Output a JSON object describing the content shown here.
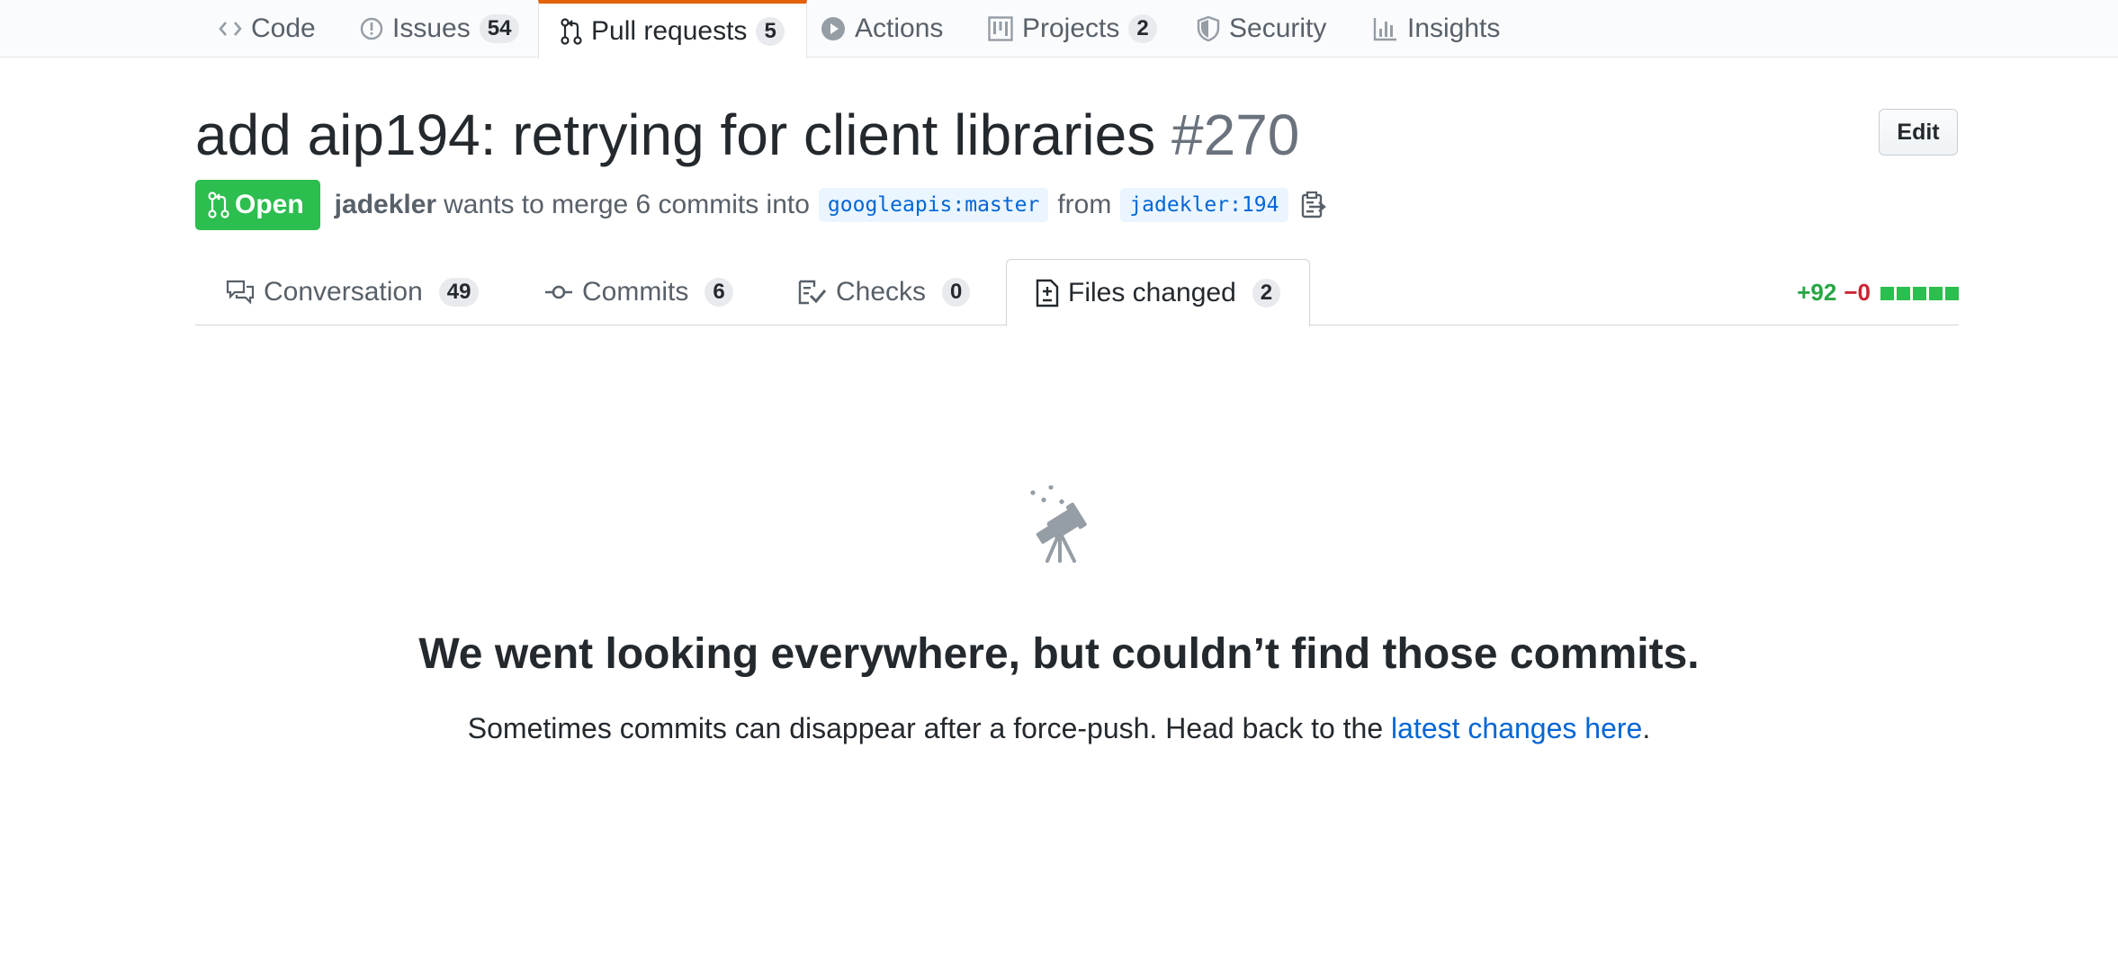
{
  "repo_nav": {
    "items": [
      {
        "label": "Code",
        "icon": "code-icon"
      },
      {
        "label": "Issues",
        "icon": "issue-opened-icon",
        "count": "54"
      },
      {
        "label": "Pull requests",
        "icon": "git-pull-request-icon",
        "count": "5",
        "selected": true
      },
      {
        "label": "Actions",
        "icon": "play-icon"
      },
      {
        "label": "Projects",
        "icon": "project-icon",
        "count": "2"
      },
      {
        "label": "Security",
        "icon": "shield-icon"
      },
      {
        "label": "Insights",
        "icon": "graph-icon"
      }
    ]
  },
  "pr": {
    "title": "add aip194: retrying for client libraries",
    "number": "#270",
    "edit_label": "Edit",
    "state_label": "Open",
    "author": "jadekler",
    "merge_text": "wants to merge 6 commits into",
    "base_ref": "googleapis:master",
    "from_text": "from",
    "head_ref": "jadekler:194"
  },
  "tabs": [
    {
      "label": "Conversation",
      "icon": "comment-discussion-icon",
      "count": "49"
    },
    {
      "label": "Commits",
      "icon": "git-commit-icon",
      "count": "6"
    },
    {
      "label": "Checks",
      "icon": "checklist-icon",
      "count": "0"
    },
    {
      "label": "Files changed",
      "icon": "file-diff-icon",
      "count": "2",
      "selected": true
    }
  ],
  "diffstat": {
    "additions": "+92",
    "deletions": "−0",
    "blocks": 5
  },
  "blankslate": {
    "icon": "telescope-icon",
    "heading": "We went looking everywhere, but couldn’t find those commits.",
    "body_prefix": "Sometimes commits can disappear after a force-push. Head back to the",
    "link_text": "latest changes here",
    "body_suffix": "."
  },
  "colors": {
    "open_green": "#2cbe4e",
    "link_blue": "#0366d6",
    "tab_accent_orange": "#e36209",
    "addition_green": "#28a745",
    "deletion_red": "#cb2431"
  }
}
